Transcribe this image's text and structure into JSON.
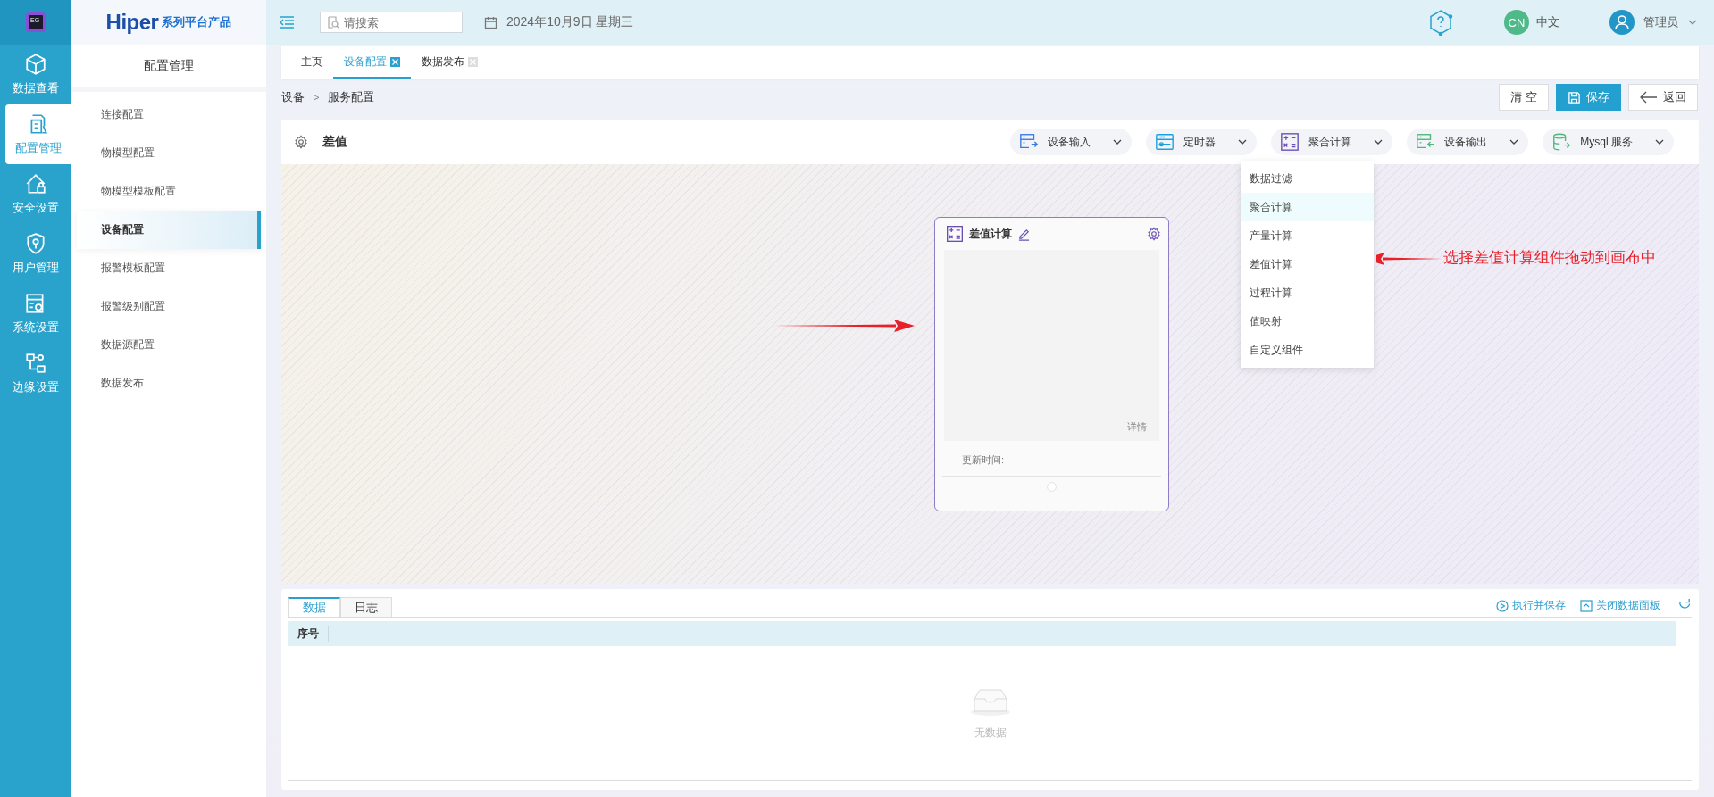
{
  "logo_text": "EG",
  "rail": {
    "items": [
      {
        "label": "数据查看",
        "selected": false
      },
      {
        "label": "配置管理",
        "selected": true
      },
      {
        "label": "安全设置",
        "selected": false
      },
      {
        "label": "用户管理",
        "selected": false
      },
      {
        "label": "系统设置",
        "selected": false
      },
      {
        "label": "边缘设置",
        "selected": false
      }
    ]
  },
  "brand": {
    "name": "Hiper",
    "tagline": "系列平台产品"
  },
  "sidebar": {
    "title": "配置管理",
    "items": [
      {
        "label": "连接配置",
        "selected": false
      },
      {
        "label": "物模型配置",
        "selected": false
      },
      {
        "label": "物模型模板配置",
        "selected": false
      },
      {
        "label": "设备配置",
        "selected": true
      },
      {
        "label": "报警模板配置",
        "selected": false
      },
      {
        "label": "报警级别配置",
        "selected": false
      },
      {
        "label": "数据源配置",
        "selected": false
      },
      {
        "label": "数据发布",
        "selected": false
      }
    ]
  },
  "topbar": {
    "search": {
      "placeholder": "请搜索"
    },
    "date": "2024年10月9日 星期三",
    "language": {
      "badge": "CN",
      "label": "中文"
    },
    "user": "管理员"
  },
  "tabs": [
    {
      "label": "主页",
      "selected": false,
      "closable": false
    },
    {
      "label": "设备配置",
      "selected": true,
      "closable": true
    },
    {
      "label": "数据发布",
      "selected": false,
      "closable": true
    }
  ],
  "breadcrumb": {
    "items": [
      "设备",
      "服务配置"
    ],
    "separator": ">"
  },
  "actions": [
    {
      "label": "清 空",
      "kind": "plain"
    },
    {
      "label": "保存",
      "kind": "primary"
    },
    {
      "label": "返回",
      "kind": "back"
    }
  ],
  "flow": {
    "title": "差值",
    "components": [
      {
        "label": "设备输入"
      },
      {
        "label": "定时器"
      },
      {
        "label": "聚合计算"
      },
      {
        "label": "设备输出"
      },
      {
        "label": "Mysql 服务"
      }
    ]
  },
  "dropdown": {
    "items": [
      {
        "label": "数据过滤",
        "selected": false
      },
      {
        "label": "聚合计算",
        "selected": true
      },
      {
        "label": "产量计算",
        "selected": false
      },
      {
        "label": "差值计算",
        "selected": false
      },
      {
        "label": "过程计算",
        "selected": false
      },
      {
        "label": "值映射",
        "selected": false
      },
      {
        "label": "自定义组件",
        "selected": false
      }
    ]
  },
  "node": {
    "title": "差值计算",
    "detail": "详情",
    "updated_label": "更新时间:"
  },
  "annotation": {
    "text": "选择差值计算组件拖动到画布中"
  },
  "panel": {
    "tabs": [
      {
        "label": "数据",
        "selected": true
      },
      {
        "label": "日志",
        "selected": false
      }
    ],
    "actions": [
      "执行并保存",
      "关闭数据面板"
    ],
    "columns": [
      "序号"
    ],
    "empty": "无数据"
  }
}
